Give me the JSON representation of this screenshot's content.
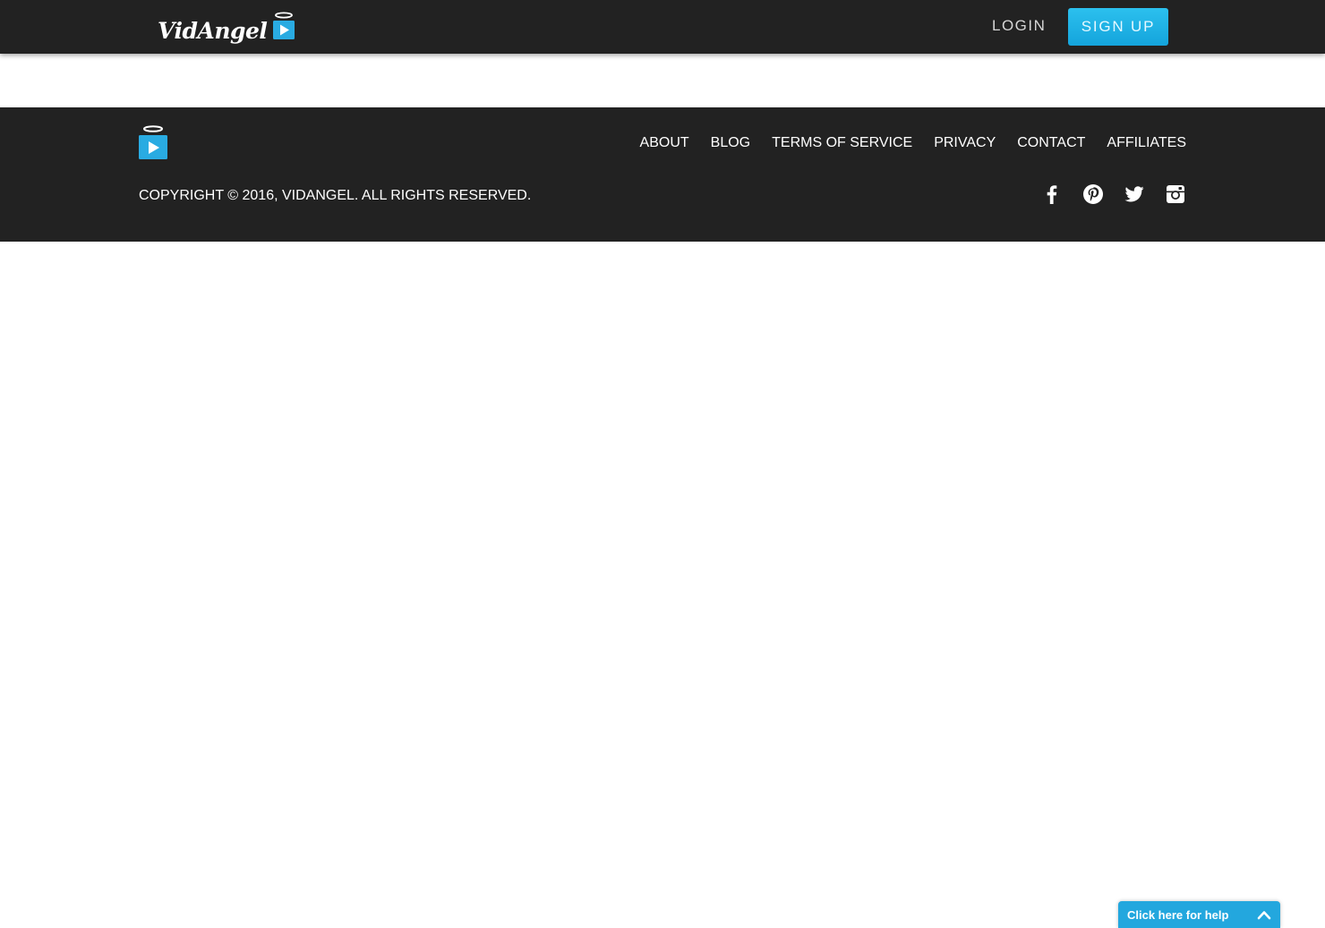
{
  "header": {
    "logo_text": "VidAngel",
    "login_label": "LOGIN",
    "signup_label": "SIGN UP"
  },
  "footer": {
    "nav": [
      {
        "label": "ABOUT"
      },
      {
        "label": "BLOG"
      },
      {
        "label": "TERMS OF SERVICE"
      },
      {
        "label": "PRIVACY"
      },
      {
        "label": "CONTACT"
      },
      {
        "label": "AFFILIATES"
      }
    ],
    "copyright": "COPYRIGHT © 2016, VIDANGEL. ALL RIGHTS RESERVED.",
    "social_icons": [
      "facebook-icon",
      "pinterest-icon",
      "twitter-icon",
      "instagram-icon"
    ]
  },
  "help_widget": {
    "label": "Click here for help"
  },
  "colors": {
    "bar_background": "#222222",
    "accent": "#23a7de",
    "text": "#ffffff"
  }
}
